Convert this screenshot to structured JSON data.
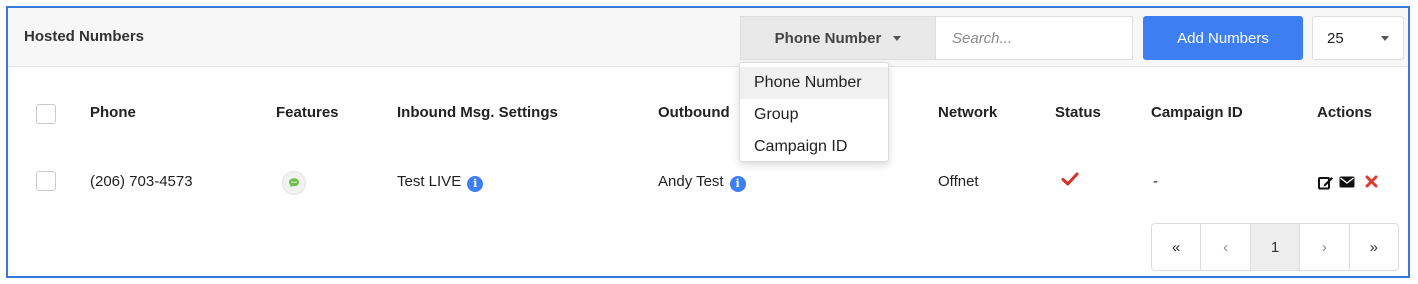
{
  "header": {
    "title": "Hosted Numbers",
    "filter_label": "Phone Number",
    "search_placeholder": "Search...",
    "add_button": "Add Numbers",
    "per_page": "25"
  },
  "filter_dropdown": {
    "options": [
      "Phone Number",
      "Group",
      "Campaign ID"
    ],
    "selected": "Phone Number"
  },
  "table": {
    "columns": [
      "Phone",
      "Features",
      "Inbound Msg. Settings",
      "Outbound",
      "Network",
      "Status",
      "Campaign ID",
      "Actions"
    ],
    "rows": [
      {
        "phone": "(206) 703-4573",
        "features": [
          "sms-icon"
        ],
        "inbound": "Test LIVE",
        "outbound": "Andy Test",
        "network": "Offnet",
        "status": "check-icon",
        "campaign_id": "-",
        "actions": [
          "edit-icon",
          "mail-icon",
          "delete-icon"
        ]
      }
    ]
  },
  "pagination": {
    "first": "«",
    "prev": "‹",
    "current": "1",
    "next": "›",
    "last": "»"
  },
  "colors": {
    "accent": "#3d7ef2",
    "frame_border": "#3a78d8",
    "status_check": "#d93025",
    "delete": "#e03a2f",
    "sms_icon": "#6cc04a"
  }
}
